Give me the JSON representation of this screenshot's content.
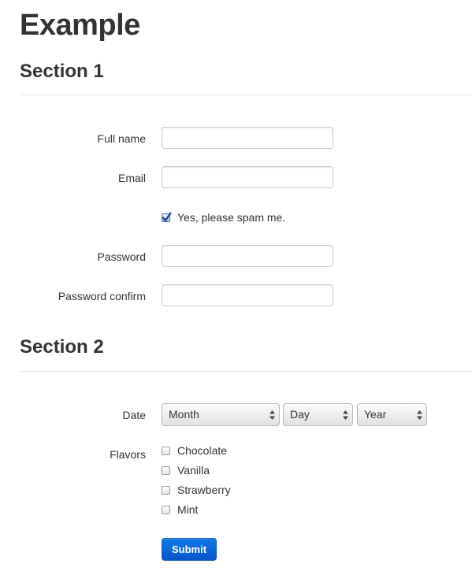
{
  "page_title": "Example",
  "section1": {
    "title": "Section 1",
    "fields": {
      "full_name": {
        "label": "Full name",
        "value": ""
      },
      "email": {
        "label": "Email",
        "value": ""
      },
      "password": {
        "label": "Password",
        "value": ""
      },
      "password_confirm": {
        "label": "Password confirm",
        "value": ""
      }
    },
    "spam_checkbox": {
      "label": "Yes, please spam me.",
      "checked": true
    }
  },
  "section2": {
    "title": "Section 2",
    "date": {
      "label": "Date",
      "month": "Month",
      "day": "Day",
      "year": "Year"
    },
    "flavors": {
      "label": "Flavors",
      "options": [
        {
          "label": "Chocolate",
          "checked": false
        },
        {
          "label": "Vanilla",
          "checked": false
        },
        {
          "label": "Strawberry",
          "checked": false
        },
        {
          "label": "Mint",
          "checked": false
        }
      ]
    }
  },
  "submit_label": "Submit",
  "colors": {
    "primary_button": "#0a66d9",
    "checkbox_accent": "#3b6fb6",
    "text": "#333333",
    "border": "#cccccc"
  },
  "icons": {
    "checkmark": "checkmark-icon",
    "select_arrows": "updown-arrows-icon"
  }
}
